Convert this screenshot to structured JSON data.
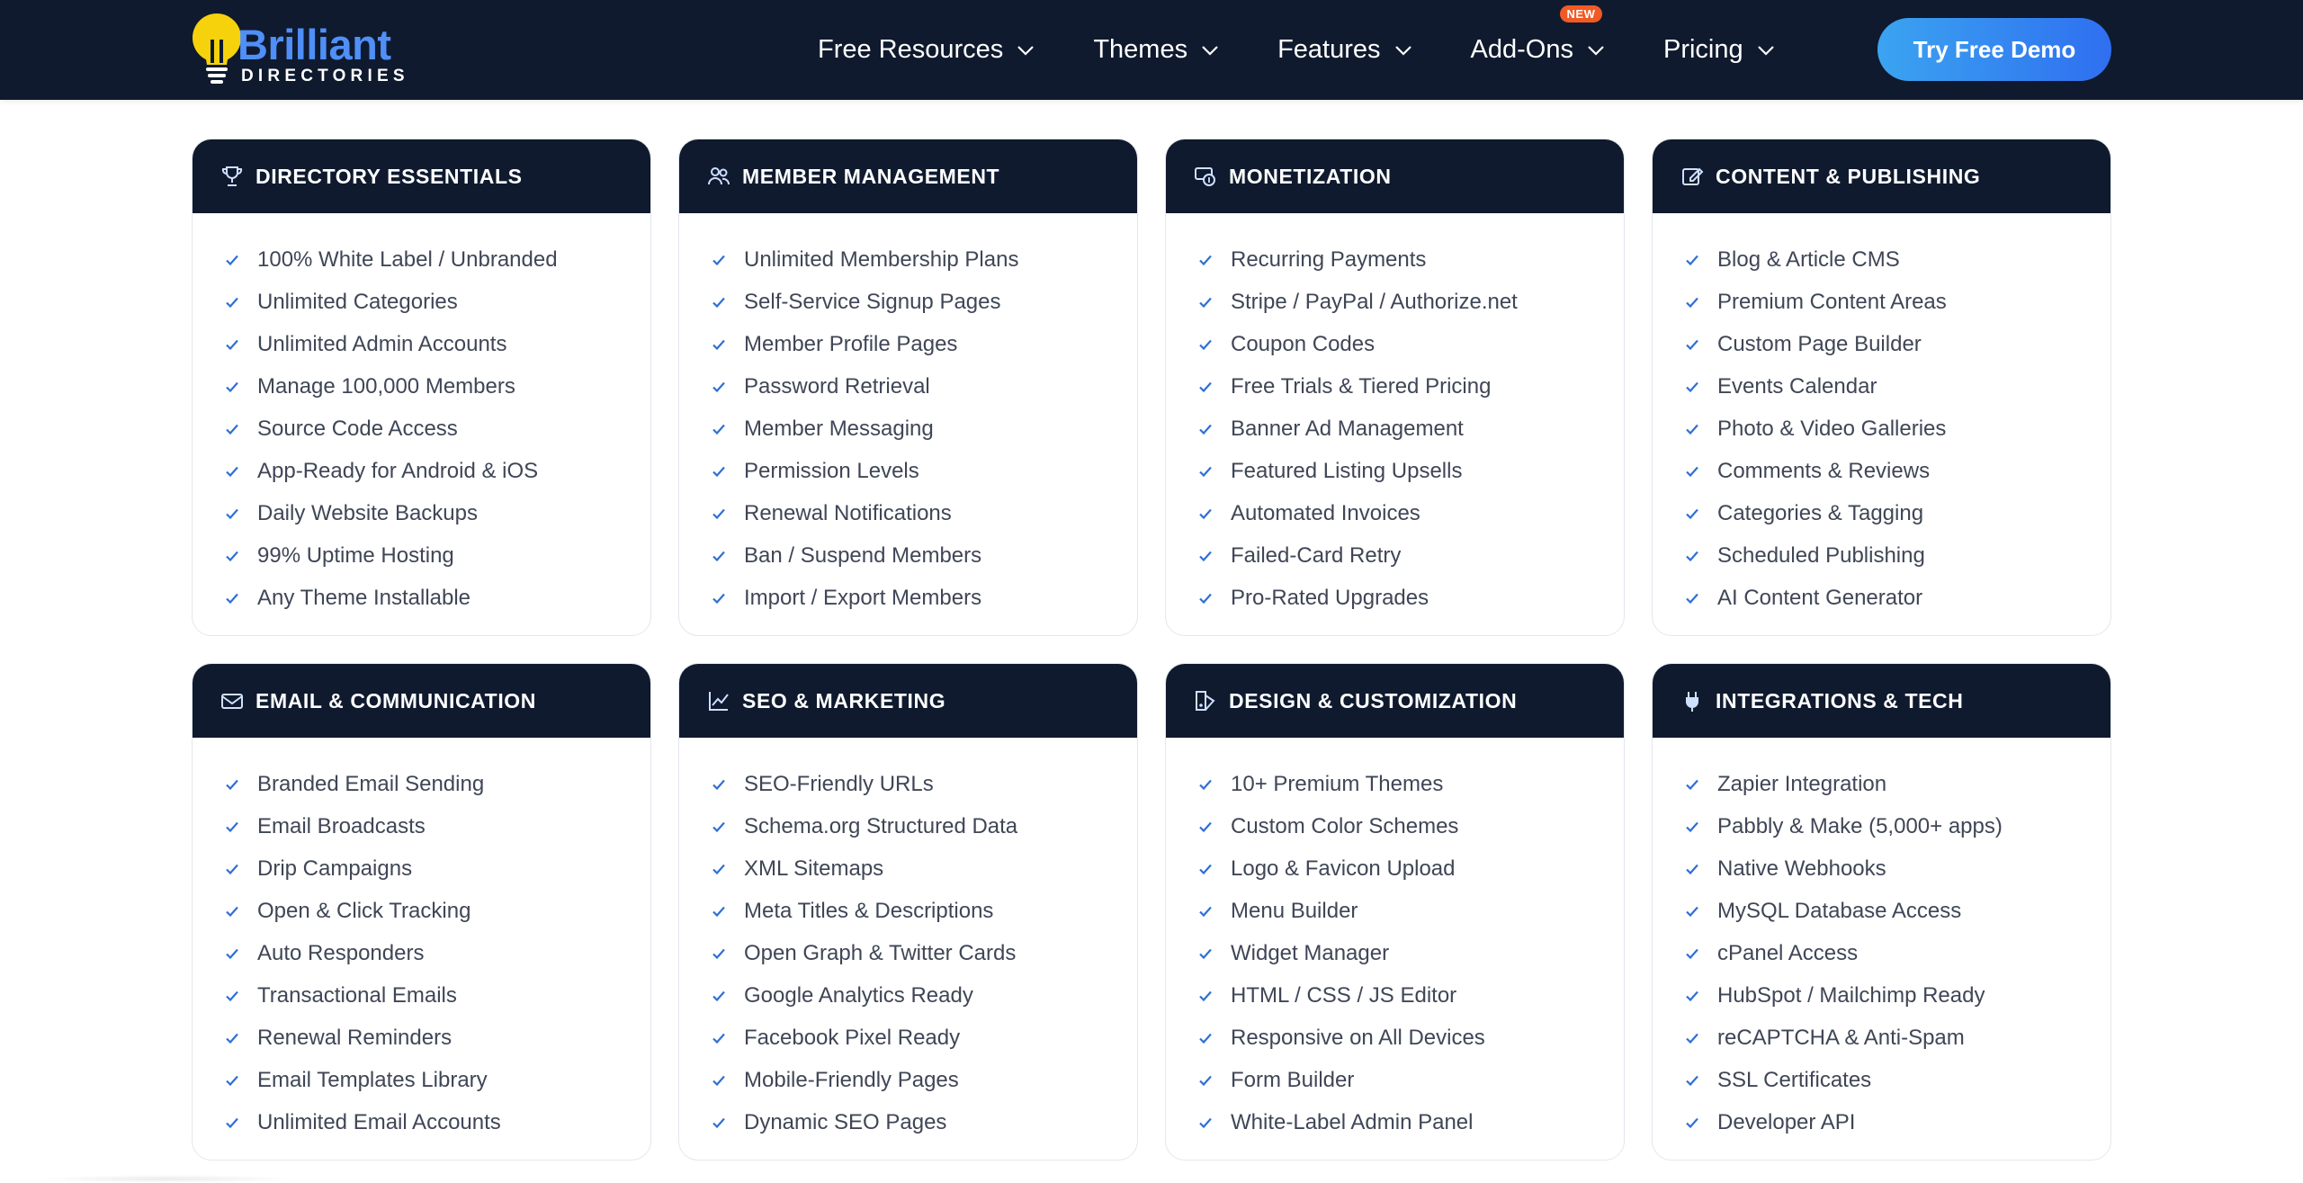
{
  "brand": {
    "logo_main_a": "Br",
    "logo_main_b": "illiant",
    "logo_sub": "DIRECTORIES"
  },
  "nav": {
    "items": [
      {
        "label": "Free Resources"
      },
      {
        "label": "Themes"
      },
      {
        "label": "Features"
      },
      {
        "label": "Add-Ons",
        "badge": "NEW"
      },
      {
        "label": "Pricing"
      }
    ],
    "cta": "Try Free Demo"
  },
  "colors": {
    "navy": "#0f1a2e",
    "accent_blue": "#2f6ff0",
    "check_blue": "#2f6fd6",
    "badge_orange": "#f05a24"
  },
  "cards": [
    {
      "title": "DIRECTORY ESSENTIALS",
      "icon": "trophy-icon",
      "items": [
        "100% White Label / Unbranded",
        "Unlimited Categories",
        "Unlimited Admin Accounts",
        "Manage 100,000 Members",
        "Source Code Access",
        "App-Ready for Android & iOS",
        "Daily Website Backups",
        "99% Uptime Hosting",
        "Any Theme Installable"
      ]
    },
    {
      "title": "MEMBER MANAGEMENT",
      "icon": "users-icon",
      "items": [
        "Unlimited Membership Plans",
        "Self-Service Signup Pages",
        "Member Profile Pages",
        "Password Retrieval",
        "Member Messaging",
        "Permission Levels",
        "Renewal Notifications",
        "Ban / Suspend Members",
        "Import / Export Members"
      ]
    },
    {
      "title": "MONETIZATION",
      "icon": "money-icon",
      "items": [
        "Recurring Payments",
        "Stripe / PayPal / Authorize.net",
        "Coupon Codes",
        "Free Trials & Tiered Pricing",
        "Banner Ad Management",
        "Featured Listing Upsells",
        "Automated Invoices",
        "Failed-Card Retry",
        "Pro-Rated Upgrades"
      ]
    },
    {
      "title": "CONTENT & PUBLISHING",
      "icon": "edit-icon",
      "items": [
        "Blog & Article CMS",
        "Premium Content Areas",
        "Custom Page Builder",
        "Events Calendar",
        "Photo & Video Galleries",
        "Comments & Reviews",
        "Categories & Tagging",
        "Scheduled Publishing",
        "AI Content Generator"
      ]
    },
    {
      "title": "EMAIL & COMMUNICATION",
      "icon": "envelope-icon",
      "items": [
        "Branded Email Sending",
        "Email Broadcasts",
        "Drip Campaigns",
        "Open & Click Tracking",
        "Auto Responders",
        "Transactional Emails",
        "Renewal Reminders",
        "Email Templates Library",
        "Unlimited Email Accounts"
      ]
    },
    {
      "title": "SEO & MARKETING",
      "icon": "chart-line-icon",
      "items": [
        "SEO-Friendly URLs",
        "Schema.org Structured Data",
        "XML Sitemaps",
        "Meta Titles & Descriptions",
        "Open Graph & Twitter Cards",
        "Google Analytics Ready",
        "Facebook Pixel Ready",
        "Mobile-Friendly Pages",
        "Dynamic SEO Pages"
      ]
    },
    {
      "title": "DESIGN & CUSTOMIZATION",
      "icon": "palette-icon",
      "items": [
        "10+ Premium Themes",
        "Custom Color Schemes",
        "Logo & Favicon Upload",
        "Menu Builder",
        "Widget Manager",
        "HTML / CSS / JS Editor",
        "Responsive on All Devices",
        "Form Builder",
        "White-Label Admin Panel"
      ]
    },
    {
      "title": "INTEGRATIONS & TECH",
      "icon": "plug-icon",
      "items": [
        "Zapier Integration",
        "Pabbly & Make (5,000+ apps)",
        "Native Webhooks",
        "MySQL Database Access",
        "cPanel Access",
        "HubSpot / Mailchimp Ready",
        "reCAPTCHA & Anti-Spam",
        "SSL Certificates",
        "Developer API"
      ]
    }
  ]
}
